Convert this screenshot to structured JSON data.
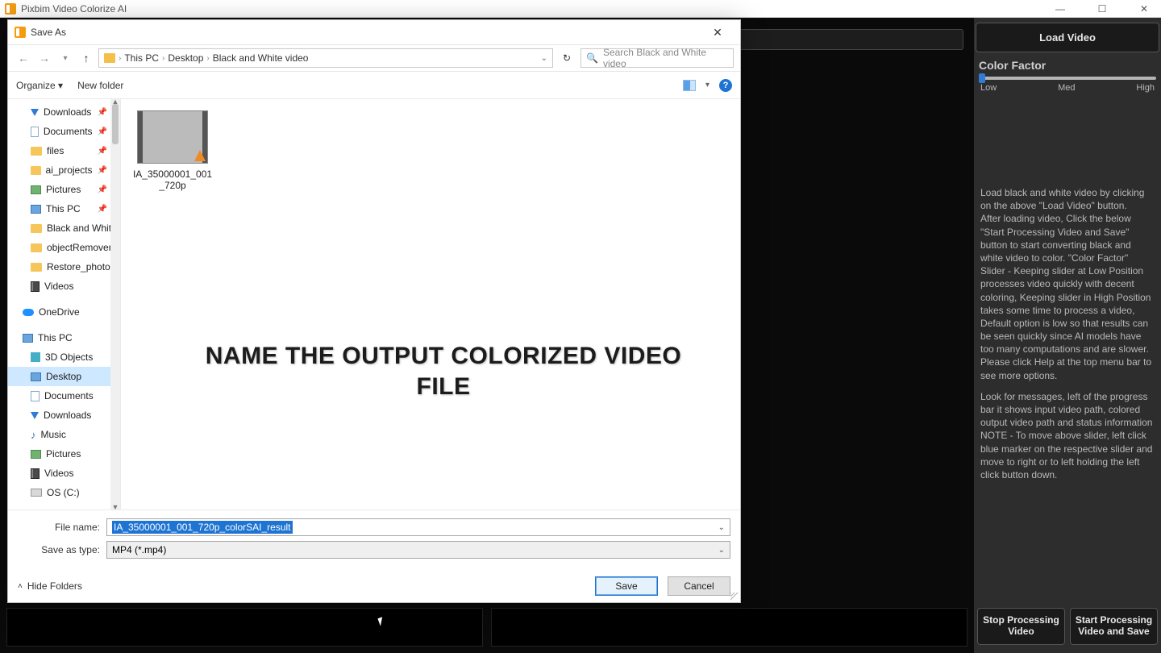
{
  "app": {
    "title": "Pixbim Video Colorize AI"
  },
  "rightPanel": {
    "loadBtn": "Load Video",
    "colorFactorLabel": "Color Factor",
    "sliderLabels": {
      "low": "Low",
      "med": "Med",
      "high": "High"
    },
    "instructions_p1": "Load black and white video by clicking on the above \"Load Video\" button.\nAfter loading video, Click the below \"Start Processing Video and Save\" button to start converting black and white video to color. \"Color Factor\" Slider - Keeping slider at Low Position processes video quickly with decent coloring, Keeping slider in High Position takes some time to process a video, Default option is low so that results can be seen quickly since AI models have too many computations and are slower. Please click Help at the top menu bar to see more options.",
    "instructions_p2": "Look for messages, left of the progress bar it shows input video path, colored output video path and status information\nNOTE - To move above slider, left click blue marker on the respective slider and move to right or to left holding the left click button down.",
    "stopBtn": "Stop Processing\nVideo",
    "startBtn": "Start Processing\nVideo and Save"
  },
  "dialog": {
    "title": "Save As",
    "breadcrumb": {
      "pc": "This PC",
      "desktop": "Desktop",
      "folder": "Black and White video"
    },
    "searchPlaceholder": "Search Black and White video",
    "organize": "Organize",
    "newFolder": "New folder",
    "navItems": {
      "downloads": "Downloads",
      "documents": "Documents",
      "files": "files",
      "ai_projects": "ai_projects",
      "pictures": "Pictures",
      "thispc_q": "This PC",
      "bw": "Black and White",
      "objRem": "objectRemoverS",
      "restore": "Restore_photos",
      "videos": "Videos",
      "onedrive": "OneDrive",
      "thispc": "This PC",
      "obj3d": "3D Objects",
      "desktop": "Desktop",
      "documents2": "Documents",
      "downloads2": "Downloads",
      "music": "Music",
      "pictures2": "Pictures",
      "videos2": "Videos",
      "osc": "OS (C:)"
    },
    "fileItem": {
      "name": "IA_35000001_001_720p"
    },
    "overlay": "NAME THE OUTPUT COLORIZED VIDEO FILE",
    "fileNameLabel": "File name:",
    "fileNameValue": "IA_35000001_001_720p_colorSAI_result",
    "saveTypeLabel": "Save as type:",
    "saveTypeValue": "MP4 (*.mp4)",
    "hideFolders": "Hide Folders",
    "saveBtn": "Save",
    "cancelBtn": "Cancel"
  }
}
